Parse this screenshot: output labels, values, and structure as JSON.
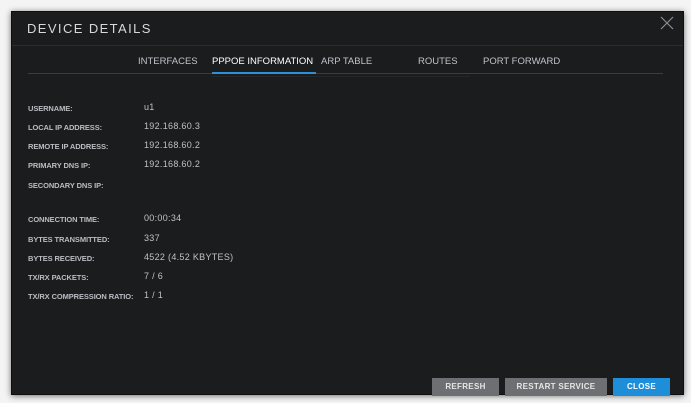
{
  "dialog": {
    "title": "DEVICE DETAILS",
    "close_icon": "close-x-icon"
  },
  "tabs": [
    {
      "label": "INTERFACES",
      "active": false
    },
    {
      "label": "PPPOE INFORMATION",
      "active": true
    },
    {
      "label": "ARP TABLE",
      "active": false
    },
    {
      "label": "ROUTES",
      "active": false
    },
    {
      "label": "PORT FORWARD",
      "active": false
    }
  ],
  "pppoe": {
    "username_label": "USERNAME:",
    "username_value": "u1",
    "local_ip_label": "LOCAL IP ADDRESS:",
    "local_ip_value": "192.168.60.3",
    "remote_ip_label": "REMOTE IP ADDRESS:",
    "remote_ip_value": "192.168.60.2",
    "primary_dns_label": "PRIMARY DNS IP:",
    "primary_dns_value": "192.168.60.2",
    "secondary_dns_label": "SECONDARY DNS IP:",
    "secondary_dns_value": "",
    "connection_time_label": "CONNECTION TIME:",
    "connection_time_value": "00:00:34",
    "bytes_tx_label": "BYTES TRANSMITTED:",
    "bytes_tx_value": "337",
    "bytes_rx_label": "BYTES RECEIVED:",
    "bytes_rx_value": "4522 (4.52 KBYTES)",
    "txrx_packets_label": "TX/RX PACKETS:",
    "txrx_packets_value": "7 / 6",
    "txrx_compression_label": "TX/RX COMPRESSION RATIO:",
    "txrx_compression_value": "1 / 1"
  },
  "buttons": {
    "refresh": "REFRESH",
    "restart_service": "RESTART SERVICE",
    "close": "CLOSE"
  },
  "colors": {
    "accent": "#1f8ed8",
    "dialog_bg": "#1b1c1e",
    "button_gray": "#6d6f73"
  }
}
